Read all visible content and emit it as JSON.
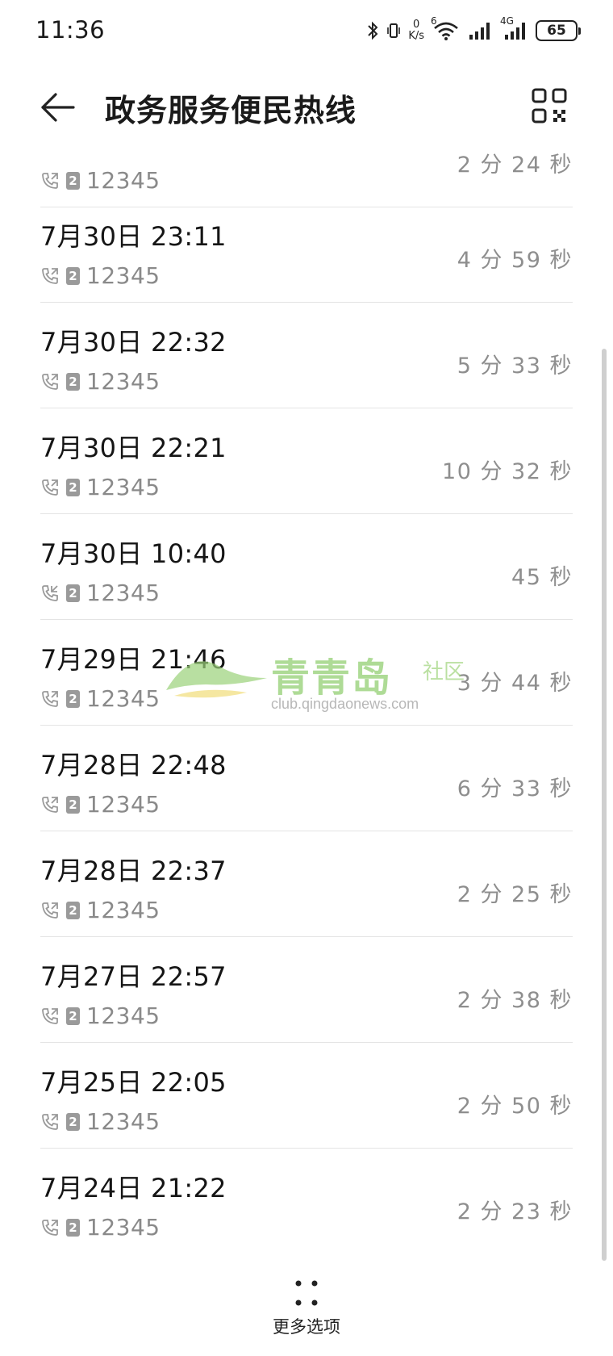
{
  "status_bar": {
    "time": "11:36",
    "net_speed_value": "0",
    "net_speed_unit": "K/s",
    "wifi_tag": "6",
    "cell_tag": "4G",
    "battery": "65"
  },
  "header": {
    "title": "政务服务便民热线",
    "back_icon": "arrow-left-icon",
    "qr_icon": "qr-code-icon"
  },
  "calls": [
    {
      "date": "",
      "number": "12345",
      "sim": "2",
      "duration": "2 分 24 秒",
      "type": "outgoing"
    },
    {
      "date": "7月30日 23:11",
      "number": "12345",
      "sim": "2",
      "duration": "4 分 59 秒",
      "type": "outgoing"
    },
    {
      "date": "7月30日 22:32",
      "number": "12345",
      "sim": "2",
      "duration": "5 分 33 秒",
      "type": "outgoing"
    },
    {
      "date": "7月30日 22:21",
      "number": "12345",
      "sim": "2",
      "duration": "10 分 32 秒",
      "type": "outgoing"
    },
    {
      "date": "7月30日 10:40",
      "number": "12345",
      "sim": "2",
      "duration": "45 秒",
      "type": "incoming"
    },
    {
      "date": "7月29日 21:46",
      "number": "12345",
      "sim": "2",
      "duration": "3 分 44 秒",
      "type": "outgoing"
    },
    {
      "date": "7月28日 22:48",
      "number": "12345",
      "sim": "2",
      "duration": "6 分 33 秒",
      "type": "outgoing"
    },
    {
      "date": "7月28日 22:37",
      "number": "12345",
      "sim": "2",
      "duration": "2 分 25 秒",
      "type": "outgoing"
    },
    {
      "date": "7月27日 22:57",
      "number": "12345",
      "sim": "2",
      "duration": "2 分 38 秒",
      "type": "outgoing"
    },
    {
      "date": "7月25日 22:05",
      "number": "12345",
      "sim": "2",
      "duration": "2 分 50 秒",
      "type": "outgoing"
    },
    {
      "date": "7月24日 21:22",
      "number": "12345",
      "sim": "2",
      "duration": "2 分 23 秒",
      "type": "outgoing"
    }
  ],
  "watermark": {
    "brand": "青青岛",
    "community": "社区",
    "url": "club.qingdaonews.com"
  },
  "footer": {
    "more_label": "更多选项"
  }
}
